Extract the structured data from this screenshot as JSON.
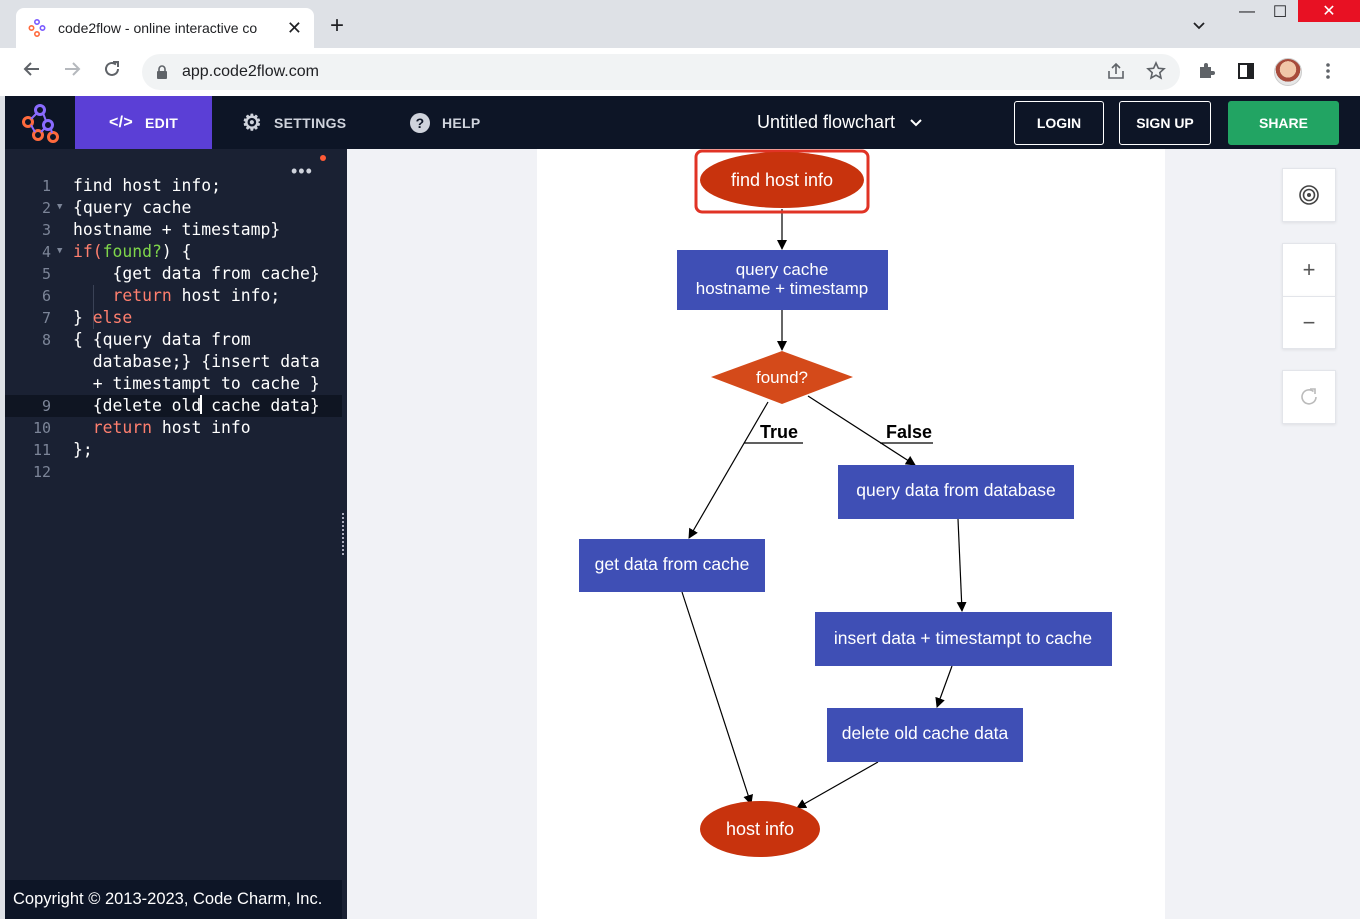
{
  "browser": {
    "tab_title": "code2flow - online interactive co",
    "tab_close": "✕",
    "new_tab": "+",
    "url": "app.code2flow.com",
    "tab_search": "⌄",
    "minimize": "—",
    "maximize": "☐",
    "close": "✕"
  },
  "header": {
    "nav": [
      {
        "icon": "</>",
        "label": "EDIT"
      },
      {
        "icon": "⚙",
        "label": "SETTINGS"
      },
      {
        "icon": "?",
        "label": "HELP"
      }
    ],
    "doc_title": "Untitled flowchart",
    "login": "LOGIN",
    "signup": "SIGN UP",
    "share": "SHARE",
    "brand_color": "#5b3fd6",
    "share_color": "#22a463"
  },
  "editor": {
    "menu": "•••",
    "lines": [
      {
        "n": "1",
        "text": "find host info;"
      },
      {
        "n": "2",
        "text": "{query cache"
      },
      {
        "n": "3",
        "text": "hostname + timestamp}"
      },
      {
        "n": "4",
        "pre": "if(",
        "green": "found?",
        "post": ") {"
      },
      {
        "n": "5",
        "text": "    {get data from cache}"
      },
      {
        "n": "6",
        "kw": "return",
        "post": " host info;",
        "indent": "    "
      },
      {
        "n": "7",
        "pre": "} ",
        "kw": "else"
      },
      {
        "n": "8",
        "text": "{ {query data from"
      },
      {
        "n": "",
        "text": "  database;} {insert data"
      },
      {
        "n": "",
        "text": "  + timestampt to cache }"
      },
      {
        "n": "9",
        "text_before": "  {delete old",
        "text_after": " cache data}"
      },
      {
        "n": "10",
        "kw": "return",
        "post": " host info",
        "indent": "  "
      },
      {
        "n": "11",
        "text": "};"
      },
      {
        "n": "12",
        "text": ""
      }
    ],
    "copyright": "Copyright © 2013-2023, Code Charm, Inc."
  },
  "flowchart": {
    "nodes": [
      {
        "id": "start",
        "shape": "ellipse",
        "label": "find host info",
        "color": "#c8330d",
        "selected": true
      },
      {
        "id": "query_cache",
        "shape": "rect",
        "lines": [
          "query cache",
          "hostname + timestamp"
        ],
        "color": "#3f4fb5"
      },
      {
        "id": "found",
        "shape": "diamond",
        "label": "found?",
        "color": "#d44a1a"
      },
      {
        "id": "get_cache",
        "shape": "rect",
        "label": "get data from cache",
        "color": "#3f4fb5"
      },
      {
        "id": "query_db",
        "shape": "rect",
        "label": "query data from database",
        "color": "#3f4fb5"
      },
      {
        "id": "insert",
        "shape": "rect",
        "label": "insert data + timestampt to cache",
        "color": "#3f4fb5"
      },
      {
        "id": "delete",
        "shape": "rect",
        "label": "delete old cache data",
        "color": "#3f4fb5"
      },
      {
        "id": "end",
        "shape": "ellipse",
        "label": "host info",
        "color": "#c8330d"
      }
    ],
    "edges": [
      {
        "from": "start",
        "to": "query_cache"
      },
      {
        "from": "query_cache",
        "to": "found"
      },
      {
        "from": "found",
        "to": "get_cache",
        "label": "True"
      },
      {
        "from": "found",
        "to": "query_db",
        "label": "False"
      },
      {
        "from": "query_db",
        "to": "insert"
      },
      {
        "from": "insert",
        "to": "delete"
      },
      {
        "from": "get_cache",
        "to": "end"
      },
      {
        "from": "delete",
        "to": "end"
      }
    ]
  },
  "controls": {
    "target": "◎",
    "zoom_in": "+",
    "zoom_out": "−",
    "reset": "↻"
  }
}
